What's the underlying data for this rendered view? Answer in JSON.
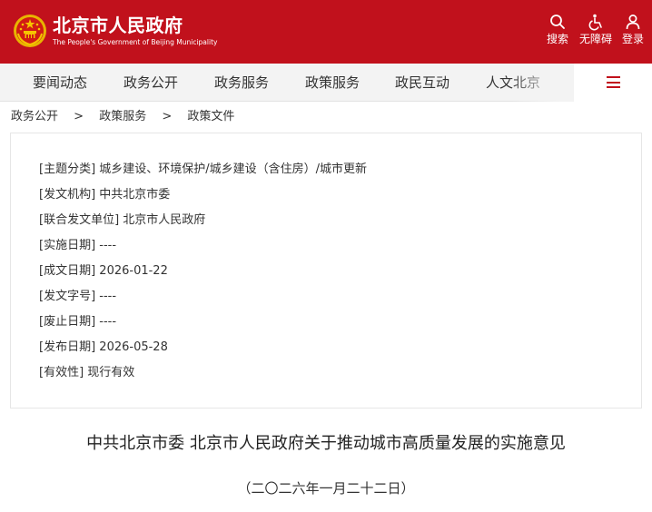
{
  "header": {
    "title": "北京市人民政府",
    "subtitle": "The People's Government of Beijing Municipality",
    "brand_color": "#c1111c",
    "tools": [
      {
        "label": "搜索",
        "icon": "search-icon"
      },
      {
        "label": "无障碍",
        "icon": "accessibility-icon"
      },
      {
        "label": "登录",
        "icon": "user-icon"
      }
    ]
  },
  "nav": {
    "items": [
      "要闻动态",
      "政务公开",
      "政务服务",
      "政策服务",
      "政民互动",
      "人文北京"
    ],
    "menu_icon": "hamburger-menu-icon"
  },
  "breadcrumb": [
    "政务公开",
    ">",
    "政策服务",
    ">",
    "政策文件"
  ],
  "info": [
    {
      "label": "[主题分类]",
      "value": "城乡建设、环境保护/城乡建设（含住房）/城市更新"
    },
    {
      "label": "[发文机构]",
      "value": "中共北京市委"
    },
    {
      "label": "[联合发文单位]",
      "value": "北京市人民政府"
    },
    {
      "label": "[实施日期]",
      "value": "----"
    },
    {
      "label": "[成文日期]",
      "value": "2026-01-22"
    },
    {
      "label": "[发文字号]",
      "value": "----"
    },
    {
      "label": "[废止日期]",
      "value": "----"
    },
    {
      "label": "[发布日期]",
      "value": "2026-05-28"
    },
    {
      "label": "[有效性]",
      "value": "现行有效"
    }
  ],
  "document": {
    "title": "中共北京市委 北京市人民政府关于推动城市高质量发展的实施意见",
    "date": "（二〇二六年一月二十二日）"
  }
}
